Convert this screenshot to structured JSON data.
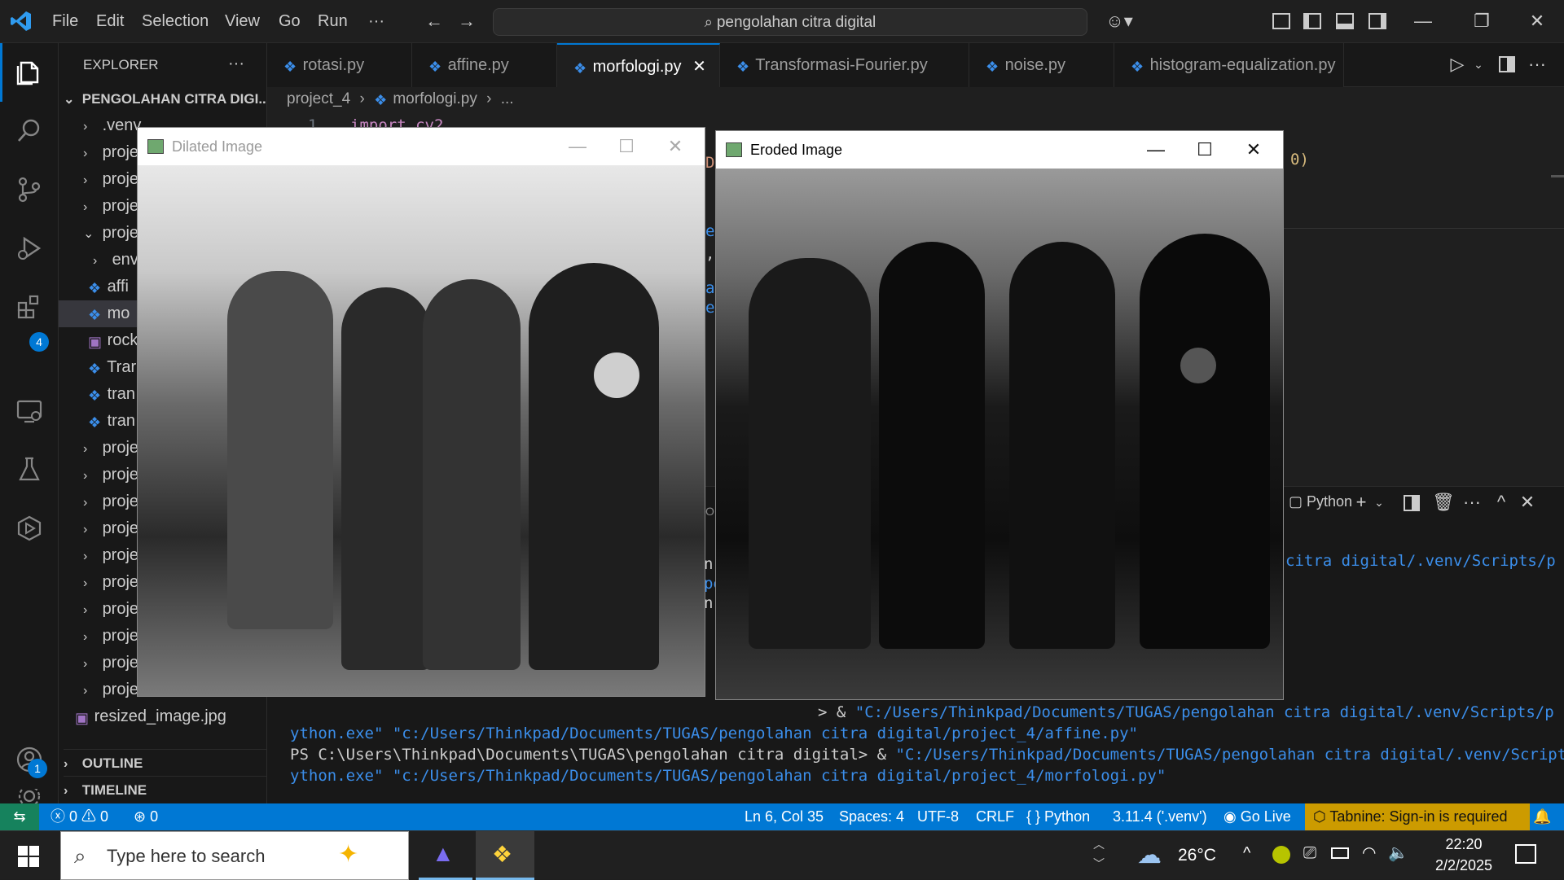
{
  "titlebar": {
    "menus": [
      "File",
      "Edit",
      "Selection",
      "View",
      "Go",
      "Run",
      "···"
    ],
    "search_text": "pengolahan citra digital"
  },
  "sidebar": {
    "header": "EXPLORER",
    "header_more": "···",
    "project": "PENGOLAHAN CITRA DIGI...",
    "items": [
      ".venv",
      "proje",
      "proje",
      "proje",
      "proje",
      "env",
      "affi",
      "mo",
      "rock",
      "Trar",
      "tran",
      "tran",
      "proje",
      "proje",
      "proje",
      "proje",
      "proje",
      "proje",
      "proje",
      "proje",
      "proje",
      "proje"
    ],
    "resized": "resized_image.jpg",
    "outline": "OUTLINE",
    "timeline": "TIMELINE"
  },
  "tabs": [
    {
      "label": "rotasi.py"
    },
    {
      "label": "affine.py"
    },
    {
      "label": "morfologi.py"
    },
    {
      "label": "Transformasi-Fourier.py"
    },
    {
      "label": "noise.py"
    },
    {
      "label": "histogram-equalization.py"
    }
  ],
  "breadcrumb": {
    "folder": "project_4",
    "file": "morfologi.py",
    "more": "..."
  },
  "editor": {
    "line_no": "1",
    "code": "import cv2",
    "frag_right": "0)",
    "frag_left_1": "D",
    "frag_left_2": "e",
    "frag_left_3": ",",
    "frag_left_4": "a",
    "frag_left_5": "e"
  },
  "panel": {
    "shell_label": "Python",
    "frag_or": "OR",
    "frag_n": "n",
    "frag_pe": "pe",
    "frag_n2": "n",
    "line_top": "citra digital/.venv/Scripts/p",
    "line1_prompt": "> & ",
    "line1_path": "\"C:/Users/Thinkpad/Documents/TUGAS/pengolahan citra digital/.venv/Scripts/p",
    "line2": "ython.exe\" \"c:/Users/Thinkpad/Documents/TUGAS/pengolahan citra digital/project_4/affine.py\"",
    "line3_prompt": "PS C:\\Users\\Thinkpad\\Documents\\TUGAS\\pengolahan citra digital> & ",
    "line3_path": "\"C:/Users/Thinkpad/Documents/TUGAS/pengolahan citra digital/.venv/Scripts/p",
    "line4": "ython.exe\" \"c:/Users/Thinkpad/Documents/TUGAS/pengolahan citra digital/project_4/morfologi.py\""
  },
  "windows": {
    "dilated_title": "Dilated Image",
    "eroded_title": "Eroded Image"
  },
  "status": {
    "errors": "0",
    "warnings": "0",
    "ports": "0",
    "position": "Ln 6, Col 35",
    "spaces": "Spaces: 4",
    "encoding": "UTF-8",
    "eol": "CRLF",
    "language": "Python",
    "interpreter": "3.11.4 ('.venv')",
    "golive": "Go Live",
    "tabnine": "Tabnine: Sign-in is required"
  },
  "taskbar": {
    "search_placeholder": "Type here to search",
    "temp": "26°C",
    "time": "22:20",
    "date": "2/2/2025"
  },
  "badges": {
    "extensions": "4",
    "account": "1"
  },
  "colors": {
    "accent": "#0078d4",
    "status_bar": "#0078d4",
    "bg": "#1f1f1f"
  }
}
